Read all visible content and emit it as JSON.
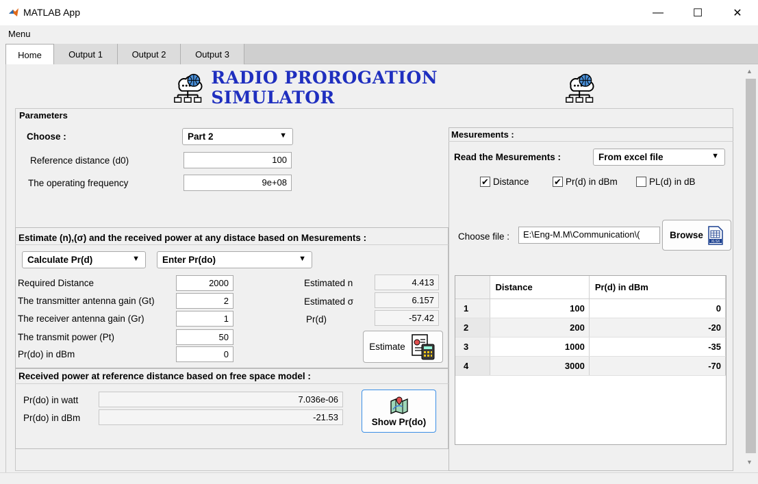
{
  "window": {
    "title": "MATLAB App",
    "minimize": "—",
    "maximize": "☐",
    "close": "✕"
  },
  "menu": {
    "label": "Menu"
  },
  "tabs": [
    {
      "label": "Home"
    },
    {
      "label": "Output 1"
    },
    {
      "label": "Output 2"
    },
    {
      "label": "Output 3"
    }
  ],
  "heading": {
    "title": "RADIO PROROGATION SIMULATOR"
  },
  "parameters": {
    "title": "Parameters",
    "choose_label": "Choose :",
    "choose_value": "Part 2",
    "ref_dist_label": "Reference distance (d0)",
    "ref_dist_value": "100",
    "freq_label": "The operating frequency",
    "freq_value": "9e+08"
  },
  "estimate": {
    "title": "Estimate (n),(σ) and the received power at any distace based on Mesurements :",
    "calc_select": "Calculate Pr(d)",
    "enter_select": "Enter Pr(do)",
    "rows": [
      {
        "label": "Required Distance",
        "value": "2000"
      },
      {
        "label": "The transmitter antenna gain (Gt)",
        "value": "2"
      },
      {
        "label": "The receiver antenna gain (Gr)",
        "value": "1"
      },
      {
        "label": "The transmit power (Pt)",
        "value": "50"
      },
      {
        "label": "Pr(do) in dBm",
        "value": "0"
      }
    ],
    "est_n_label": "Estimated n",
    "est_n_value": "4.413",
    "est_sigma_label": "Estimated σ",
    "est_sigma_value": "6.157",
    "prd_label": "Pr(d)",
    "prd_value": "-57.42",
    "button": "Estimate"
  },
  "free_space": {
    "title": "Received power at reference distance based on free space model :",
    "watt_label": "Pr(do) in watt",
    "watt_value": "7.036e-06",
    "dbm_label": "Pr(do) in dBm",
    "dbm_value": "-21.53",
    "button": "Show Pr(do)"
  },
  "measurements": {
    "title": "Mesurements :",
    "read_label": "Read the Mesurements :",
    "read_value": "From excel file",
    "checks": [
      {
        "label": "Distance",
        "checked": true
      },
      {
        "label": "Pr(d) in dBm",
        "checked": true
      },
      {
        "label": "PL(d) in dB",
        "checked": false
      }
    ],
    "file_label": "Choose file :",
    "file_value": "E:\\Eng-M.M\\Communication\\(",
    "browse": "Browse",
    "table": {
      "headers": [
        "",
        "Distance",
        "Pr(d) in dBm"
      ],
      "rows": [
        {
          "idx": "1",
          "distance": "100",
          "prd": "0"
        },
        {
          "idx": "2",
          "distance": "200",
          "prd": "-20"
        },
        {
          "idx": "3",
          "distance": "1000",
          "prd": "-35"
        },
        {
          "idx": "4",
          "distance": "3000",
          "prd": "-70"
        }
      ]
    }
  }
}
